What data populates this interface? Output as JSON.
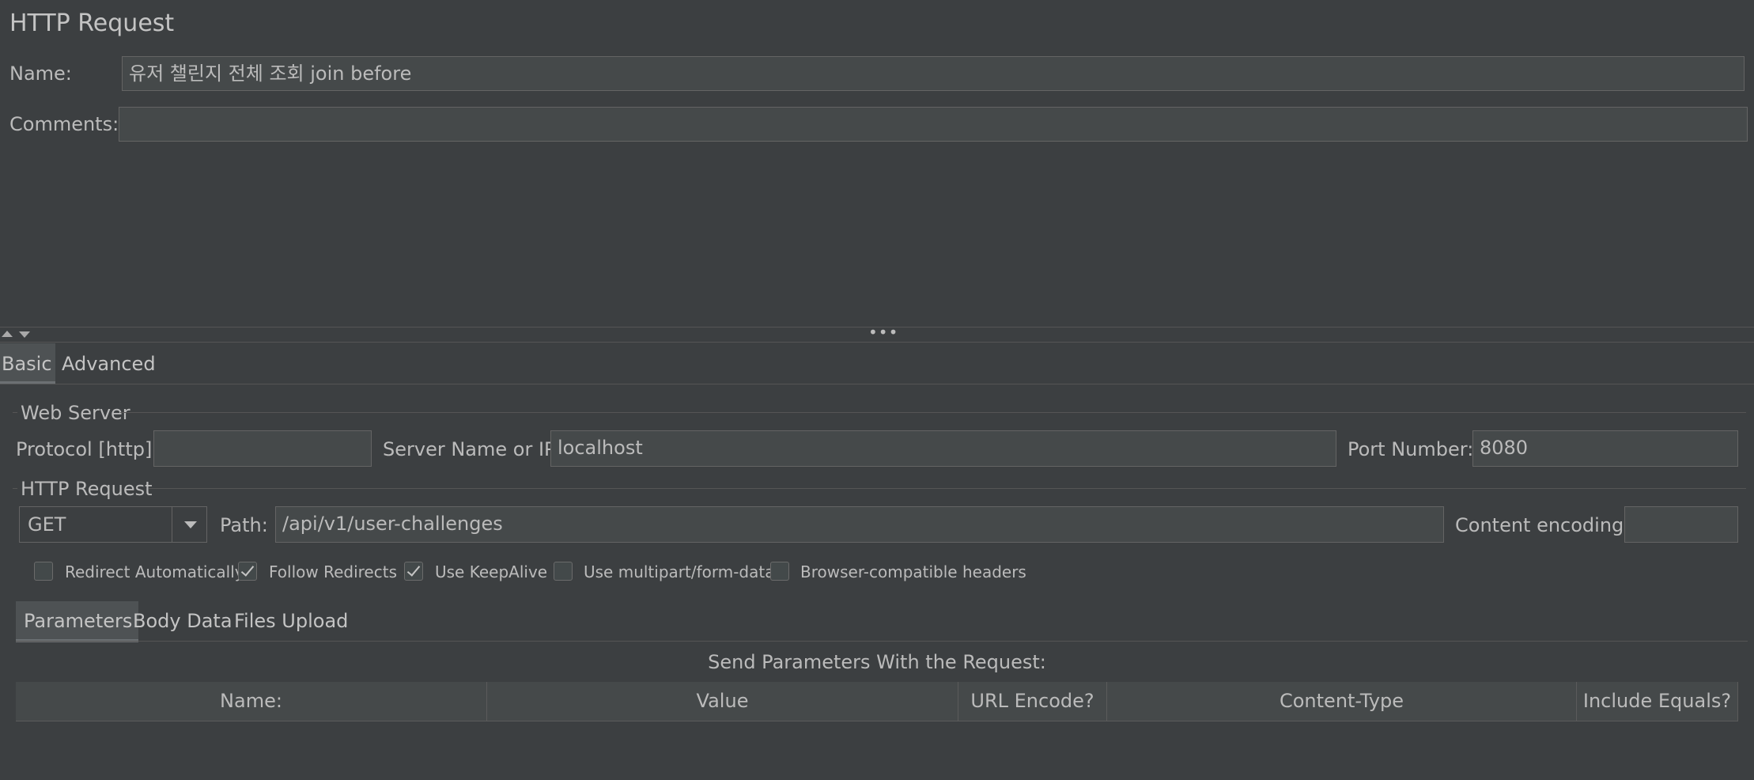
{
  "header": {
    "title": "HTTP Request",
    "name_label": "Name:",
    "name_value": "유저 챌린지 전체 조회 join before",
    "comments_label": "Comments:",
    "comments_value": ""
  },
  "main_tabs": [
    {
      "label": "Basic",
      "selected": true
    },
    {
      "label": "Advanced",
      "selected": false
    }
  ],
  "web_server": {
    "group_label": "Web Server",
    "protocol_label": "Protocol [http]:",
    "protocol_value": "",
    "server_label": "Server Name or IP:",
    "server_value": "localhost",
    "port_label": "Port Number:",
    "port_value": "8080"
  },
  "http_request": {
    "group_label": "HTTP Request",
    "method_value": "GET",
    "path_label": "Path:",
    "path_value": "/api/v1/user-challenges",
    "encoding_label": "Content encoding:",
    "encoding_value": ""
  },
  "options": [
    {
      "label": "Redirect Automatically",
      "checked": false
    },
    {
      "label": "Follow Redirects",
      "checked": true
    },
    {
      "label": "Use KeepAlive",
      "checked": true
    },
    {
      "label": "Use multipart/form-data",
      "checked": false
    },
    {
      "label": "Browser-compatible headers",
      "checked": false
    }
  ],
  "sub_tabs": [
    {
      "label": "Parameters",
      "selected": true
    },
    {
      "label": "Body Data",
      "selected": false
    },
    {
      "label": "Files Upload",
      "selected": false
    }
  ],
  "parameters": {
    "caption": "Send Parameters With the Request:",
    "columns": [
      "Name:",
      "Value",
      "URL Encode?",
      "Content-Type",
      "Include Equals?"
    ],
    "rows": []
  },
  "colors": {
    "background": "#3c3f41",
    "field_background": "#45494a",
    "text": "#bbbbbb",
    "border": "#646464"
  }
}
